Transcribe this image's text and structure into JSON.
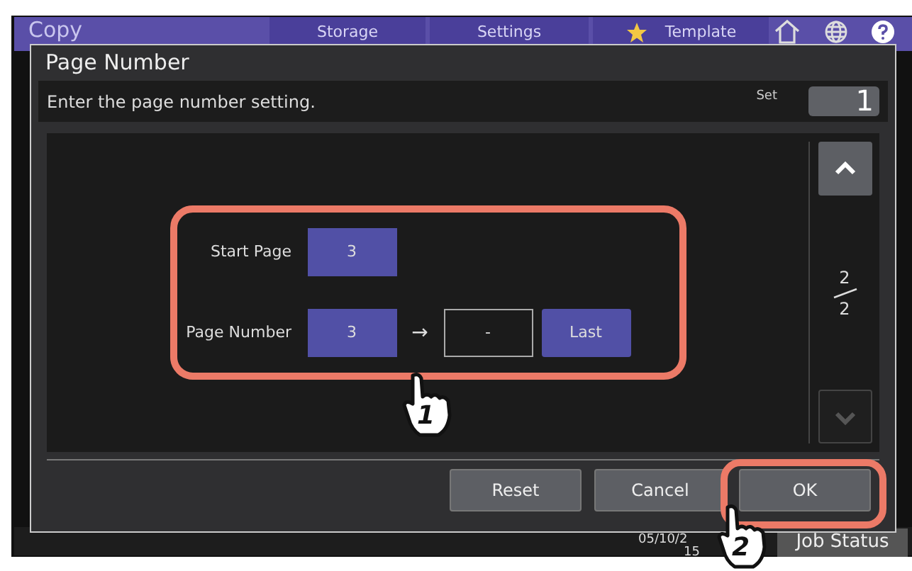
{
  "app": {
    "title": "Copy",
    "tabs": [
      {
        "label": "Storage",
        "starred": false
      },
      {
        "label": "Settings",
        "starred": false
      },
      {
        "label": "Template",
        "starred": true
      }
    ],
    "date": "05/10/2",
    "time": "15",
    "job_status": "Job Status"
  },
  "dialog": {
    "title": "Page Number",
    "instruction": "Enter the page number setting.",
    "set_label": "Set",
    "set_value": "1",
    "rows": [
      {
        "label": "Start Page",
        "value": "3"
      },
      {
        "label": "Page Number",
        "value": "3",
        "arrow": "→",
        "end_value": "-",
        "end_button": "Last"
      }
    ],
    "pager": {
      "current": "2",
      "total": "2"
    },
    "scroll_buttons": [
      {
        "kind": "up",
        "disabled": false
      },
      {
        "kind": "down",
        "disabled": true
      }
    ],
    "buttons": [
      "Reset",
      "Cancel",
      "OK"
    ]
  },
  "callouts": [
    {
      "number": "1"
    },
    {
      "number": "2"
    }
  ]
}
